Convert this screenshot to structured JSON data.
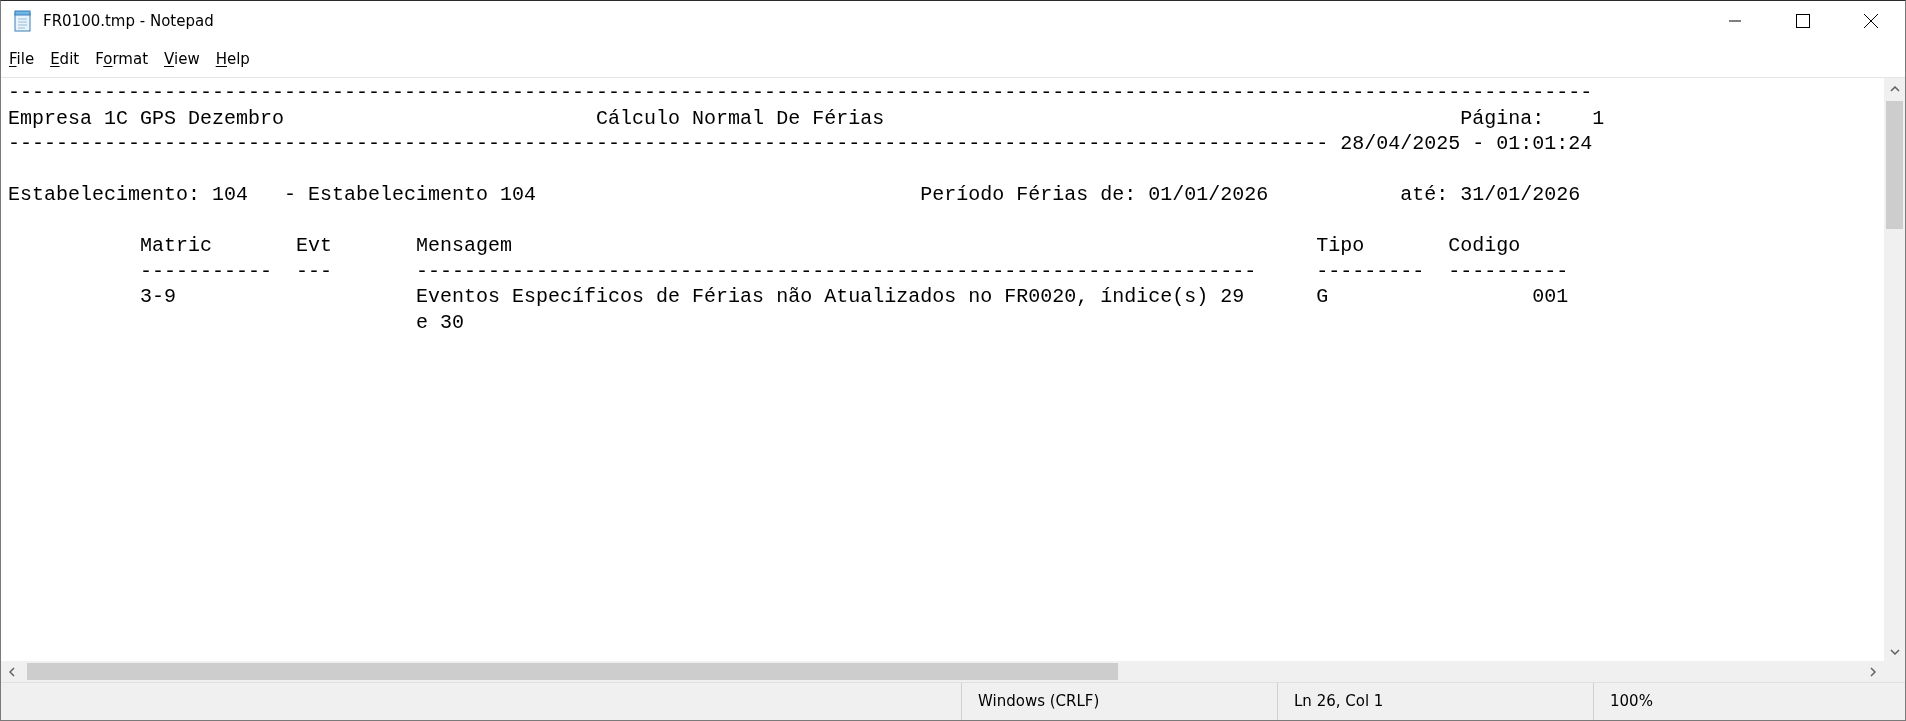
{
  "window": {
    "title": "FR0100.tmp - Notepad"
  },
  "menu": [
    {
      "parts": [
        {
          "text": "F",
          "underlined": true
        },
        {
          "text": "ile",
          "underlined": false
        }
      ]
    },
    {
      "parts": [
        {
          "text": "E",
          "underlined": true
        },
        {
          "text": "dit",
          "underlined": false
        }
      ]
    },
    {
      "parts": [
        {
          "text": "F",
          "underlined": false
        },
        {
          "text": "o",
          "underlined": true
        },
        {
          "text": "rmat",
          "underlined": false
        }
      ]
    },
    {
      "parts": [
        {
          "text": "V",
          "underlined": true
        },
        {
          "text": "iew",
          "underlined": false
        }
      ]
    },
    {
      "parts": [
        {
          "text": "H",
          "underlined": true
        },
        {
          "text": "elp",
          "underlined": false
        }
      ]
    }
  ],
  "document": {
    "blocks": [
      [
        "------------------------------------------------------------------------------------------------------------------------------------",
        "Empresa 1C GPS Dezembro                          Cálculo Normal De Férias                                                Página:    1",
        "-------------------------------------------------------------------------------------------------------------- 28/04/2025 - 01:01:24"
      ],
      [
        "Estabelecimento: 104   - Estabelecimento 104                                Período Férias de: 01/01/2026           até: 31/01/2026"
      ],
      [
        "           Matric       Evt       Mensagem                                                                   Tipo       Codigo",
        "           -----------  ---       ----------------------------------------------------------------------     ---------  ----------",
        "           3-9                    Eventos Específicos de Férias não Atualizados no FR0020, índice(s) 29      G                 001",
        "                                  e 30"
      ]
    ]
  },
  "status_bar": [
    {
      "text": "Windows (CRLF)"
    },
    {
      "text": "Ln 26, Col 1"
    },
    {
      "text": "100%"
    }
  ]
}
